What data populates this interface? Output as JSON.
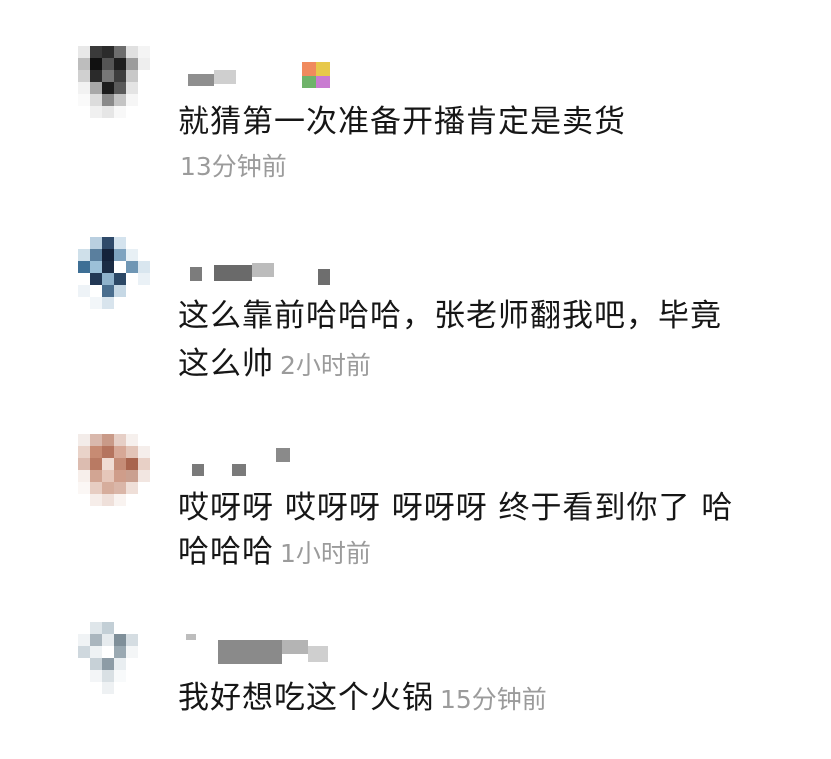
{
  "comments": [
    {
      "text": "就猜第一次准备开播肯定是卖货",
      "time": "13分钟前",
      "avatar_colors": [
        "#e8e8e8",
        "#3a3a3a",
        "#2b2b2b",
        "#6d6d6d",
        "#e0e0e0",
        "#f4f4f4",
        "#bdbdbd",
        "#111111",
        "#555555",
        "#1e1e1e",
        "#9c9c9c",
        "#eeeeee",
        "#d0d0d0",
        "#2a2a2a",
        "#777777",
        "#3d3d3d",
        "#c8c8c8",
        "#ffffff",
        "#f2f2f2",
        "#a8a8a8",
        "#1c1c1c",
        "#5a5a5a",
        "#e4e4e4",
        "#ffffff",
        "#fafafa",
        "#dcdcdc",
        "#8a8a8a",
        "#c4c4c4",
        "#f6f6f6",
        "#ffffff",
        "#ffffff",
        "#f0f0f0",
        "#e6e6e6",
        "#f8f8f8",
        "#ffffff",
        "#ffffff"
      ]
    },
    {
      "text_line1": "这么靠前哈哈哈，张老师翻我吧，毕竟",
      "text_line2": "这么帅",
      "time": "2小时前",
      "avatar_colors": [
        "#ffffff",
        "#b9cfe0",
        "#2f4a6a",
        "#d4e3ee",
        "#ffffff",
        "#ffffff",
        "#cfe0ea",
        "#5a7f9e",
        "#14223a",
        "#7fa3bf",
        "#e8f0f5",
        "#ffffff",
        "#3e6f95",
        "#9cc0d8",
        "#1b2c44",
        "#ffffff",
        "#6f96b4",
        "#d9e6ef",
        "#ffffff",
        "#223855",
        "#8fb2cb",
        "#2c4866",
        "#ffffff",
        "#eaf1f6",
        "#eef3f7",
        "#ffffff",
        "#4a6e8e",
        "#c6d8e5",
        "#ffffff",
        "#ffffff",
        "#ffffff",
        "#f2f6f9",
        "#d8e4ed",
        "#ffffff",
        "#ffffff",
        "#ffffff"
      ]
    },
    {
      "text_line1": "哎呀呀 哎呀呀 呀呀呀 终于看到你了 哈",
      "text_line2": "哈哈哈",
      "time": "1小时前",
      "avatar_colors": [
        "#f3ece9",
        "#d9b8ac",
        "#c99a88",
        "#e6cfc6",
        "#f6f0ed",
        "#ffffff",
        "#e9d3c9",
        "#c78b73",
        "#b5745e",
        "#d7a896",
        "#e2c4b7",
        "#f5eeeb",
        "#dcbcb0",
        "#b97a63",
        "#f0dcd3",
        "#c58c76",
        "#a8644d",
        "#e8d0c6",
        "#f7efeb",
        "#d2a593",
        "#e6c7ba",
        "#cf9d8a",
        "#caa090",
        "#f2e6e1",
        "#fbf7f5",
        "#e7cdc2",
        "#d6ad9c",
        "#dab6a8",
        "#efdfd8",
        "#ffffff",
        "#ffffff",
        "#f6ede9",
        "#efe0da",
        "#f9f3f0",
        "#ffffff",
        "#ffffff"
      ]
    },
    {
      "text": "我好想吃这个火锅",
      "time": "15分钟前",
      "avatar_colors": [
        "#ffffff",
        "#dfe6ea",
        "#c3cfd6",
        "#ffffff",
        "#ffffff",
        "#ffffff",
        "#f0f3f5",
        "#aab6be",
        "#e6ebee",
        "#7f8f99",
        "#d5dde2",
        "#ffffff",
        "#cfd8de",
        "#eef2f4",
        "#ffffff",
        "#9aa9b2",
        "#f4f6f7",
        "#ffffff",
        "#ffffff",
        "#c7d1d7",
        "#8d9ca6",
        "#e9eef1",
        "#ffffff",
        "#ffffff",
        "#ffffff",
        "#f3f5f7",
        "#d9e0e4",
        "#f8fafb",
        "#ffffff",
        "#ffffff",
        "#ffffff",
        "#ffffff",
        "#eef1f3",
        "#ffffff",
        "#ffffff",
        "#ffffff"
      ]
    }
  ]
}
